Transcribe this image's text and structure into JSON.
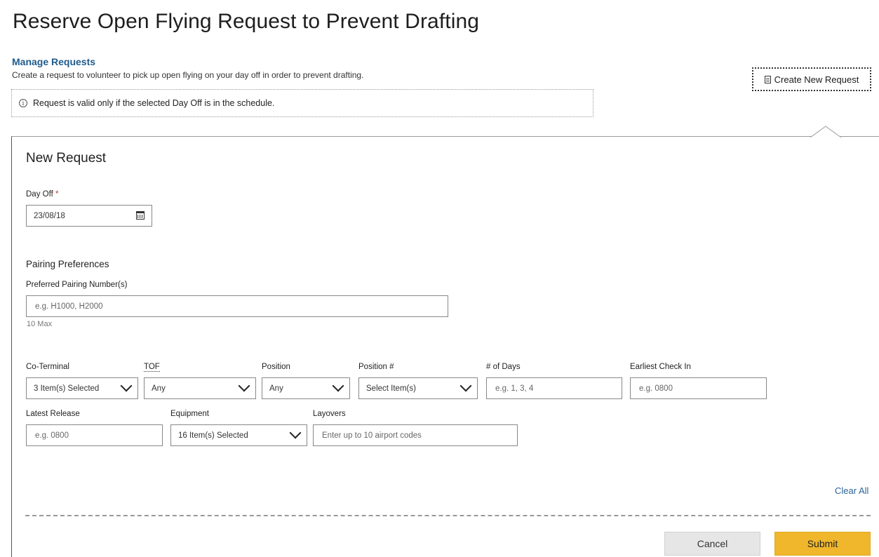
{
  "page_title": "Reserve Open Flying Request to Prevent Drafting",
  "manage": {
    "title": "Manage Requests",
    "description": "Create a request to volunteer to pick up open flying on your day off in order to prevent drafting."
  },
  "info": {
    "icon": "info-icon",
    "text": "Request is valid only if the selected Day Off is in the schedule."
  },
  "create_button": {
    "label": "Create New Request",
    "icon": "document-icon"
  },
  "form": {
    "title": "New Request",
    "day_off": {
      "label": "Day Off",
      "required_mark": "*",
      "value": "23/08/18",
      "icon": "calendar-icon"
    },
    "pairing_preferences_title": "Pairing Preferences",
    "preferred_pairing": {
      "label": "Preferred Pairing Number(s)",
      "placeholder": "e.g. H1000, H2000",
      "hint": "10 Max"
    },
    "co_terminal": {
      "label": "Co-Terminal",
      "value": "3 Item(s) Selected"
    },
    "tof": {
      "label": "TOF",
      "value": "Any"
    },
    "position": {
      "label": "Position",
      "value": "Any"
    },
    "position_num": {
      "label": "Position #",
      "value": "Select Item(s)"
    },
    "num_days": {
      "label": "# of Days",
      "placeholder": "e.g. 1, 3, 4"
    },
    "earliest_check_in": {
      "label": "Earliest Check In",
      "placeholder": "e.g. 0800"
    },
    "latest_release": {
      "label": "Latest Release",
      "placeholder": "e.g. 0800"
    },
    "equipment": {
      "label": "Equipment",
      "value": "16 Item(s) Selected"
    },
    "layovers": {
      "label": "Layovers",
      "placeholder": "Enter up to 10 airport codes"
    },
    "clear_all": "Clear All",
    "cancel": "Cancel",
    "submit": "Submit"
  },
  "colors": {
    "link": "#1f5b8c",
    "submit": "#f0b72c",
    "cancel": "#e6e6e6",
    "required": "#c0392b"
  }
}
